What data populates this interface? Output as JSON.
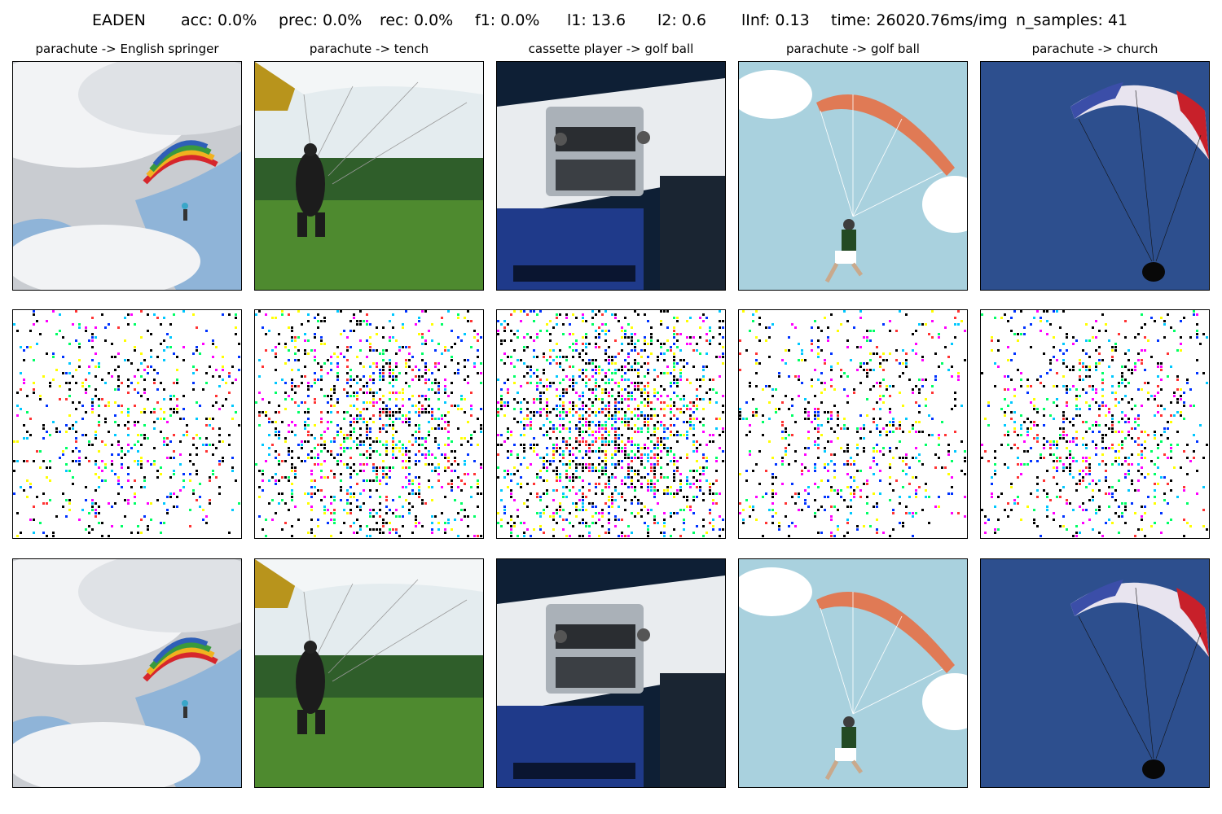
{
  "header": {
    "method": "EADEN",
    "acc": "acc: 0.0%",
    "prec": "prec: 0.0%",
    "rec": "rec: 0.0%",
    "f1": "f1: 0.0%",
    "l1": "l1: 13.6",
    "l2": "l2: 0.6",
    "linf": "lInf: 0.13",
    "time": "time: 26020.76ms/img",
    "n_samples": "n_samples: 41"
  },
  "columns": [
    {
      "title": "parachute -> English springer",
      "scene": "sky-rainbow-canopy"
    },
    {
      "title": "parachute -> tench",
      "scene": "field-paratrooper"
    },
    {
      "title": "cassette player -> golf ball",
      "scene": "car-dashboard-radio"
    },
    {
      "title": "parachute -> golf ball",
      "scene": "illustration-orange-canopy"
    },
    {
      "title": "parachute -> church",
      "scene": "blue-sky-paraglider"
    }
  ],
  "rows": [
    "original",
    "perturbation",
    "adversarial"
  ],
  "colors": {
    "sky_blue": "#8fb4d8",
    "cloud_white": "#f2f3f5",
    "grass_green": "#4e8a2f",
    "trees_green": "#2f5e2a",
    "dash_blue": "#1f3a8a",
    "illus_bg": "#a9d1de",
    "illus_canopy": "#e07a55",
    "deep_blue": "#2d4f8e",
    "canopy_red": "#c8202a"
  }
}
